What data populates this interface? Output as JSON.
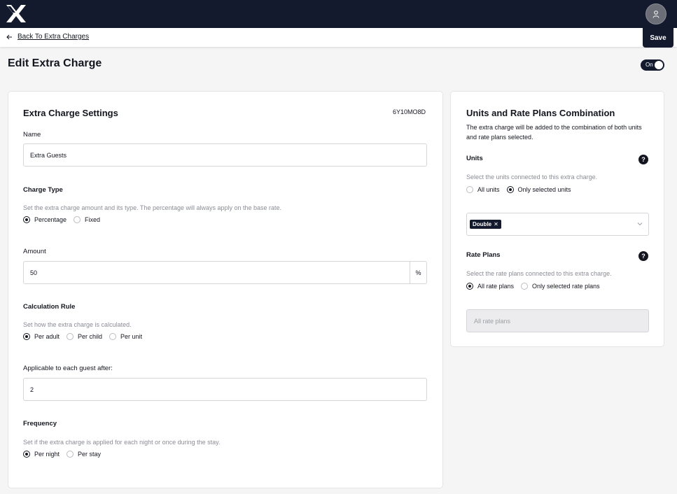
{
  "header": {
    "back_label": "Back To Extra Charges",
    "save_label": "Save",
    "logo_icon": "x-logo-icon",
    "avatar_icon": "user-icon"
  },
  "page": {
    "title": "Edit Extra Charge",
    "toggle_label": "On",
    "toggle_state": true
  },
  "settings": {
    "title": "Extra Charge Settings",
    "code": "6Y10MO8D",
    "name_label": "Name",
    "name_value": "Extra Guests",
    "charge_type": {
      "title": "Charge Type",
      "help": "Set the extra charge amount and its type. The percentage will always apply on the base rate.",
      "options": [
        "Percentage",
        "Fixed"
      ],
      "selected": "Percentage"
    },
    "amount": {
      "label": "Amount",
      "value": "50",
      "suffix": "%"
    },
    "calculation_rule": {
      "title": "Calculation Rule",
      "help": "Set how the extra charge is calculated.",
      "options": [
        "Per adult",
        "Per child",
        "Per unit"
      ],
      "selected": "Per adult"
    },
    "applicable": {
      "label": "Applicable to each guest after:",
      "value": "2"
    },
    "frequency": {
      "title": "Frequency",
      "help": "Set if the extra charge is applied for each night or once during the stay.",
      "options": [
        "Per night",
        "Per stay"
      ],
      "selected": "Per night"
    }
  },
  "combination": {
    "title": "Units and Rate Plans Combination",
    "description": "The extra charge will be added to the combination of both units and rate plans selected.",
    "units": {
      "title": "Units",
      "help": "Select the units connected to this extra charge.",
      "options": [
        "All units",
        "Only selected units"
      ],
      "selected": "Only selected units",
      "chips": [
        "Double"
      ]
    },
    "rate_plans": {
      "title": "Rate Plans",
      "help": "Select the rate plans connected to this extra charge.",
      "options": [
        "All rate plans",
        "Only selected rate plans"
      ],
      "selected": "All rate plans",
      "placeholder": "All rate plans"
    }
  },
  "colors": {
    "primary": "#141a2e",
    "background": "#f5f5f6",
    "muted_text": "#8a8d94"
  }
}
